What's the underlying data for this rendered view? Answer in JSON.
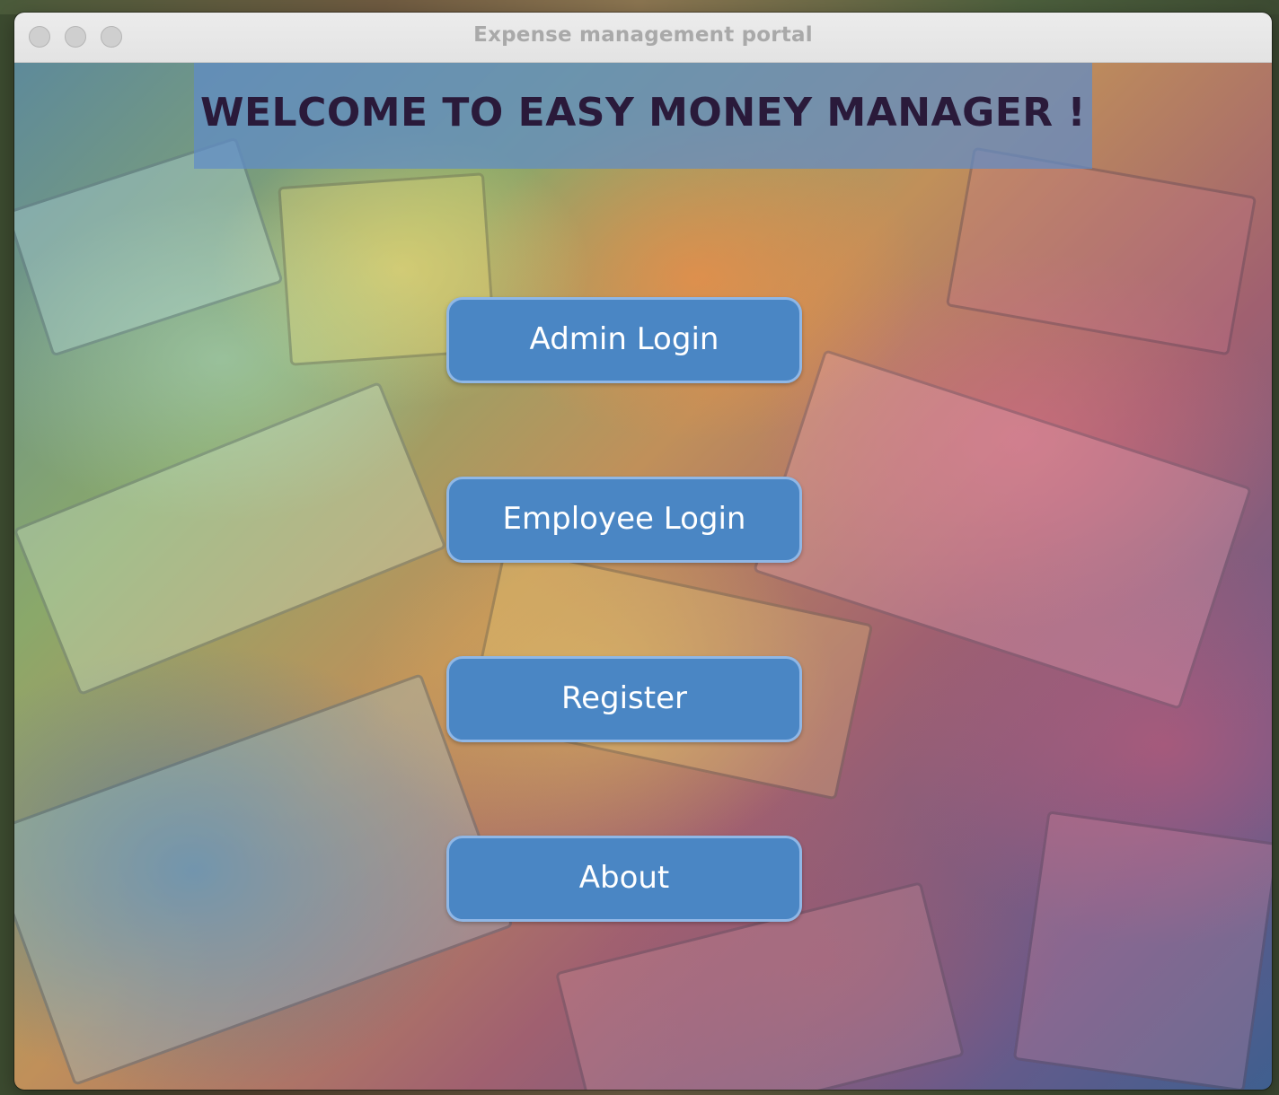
{
  "window": {
    "title": "Expense management portal"
  },
  "banner": {
    "heading": "WELCOME TO EASY MONEY MANAGER !"
  },
  "menu": {
    "admin_login": "Admin Login",
    "employee_login": "Employee Login",
    "register": "Register",
    "about": "About"
  },
  "colors": {
    "button_fill": "#4a86c4",
    "button_border": "#8fb7e6",
    "banner_fill": "#5f8cc8",
    "heading_text": "#2a1a3a"
  }
}
